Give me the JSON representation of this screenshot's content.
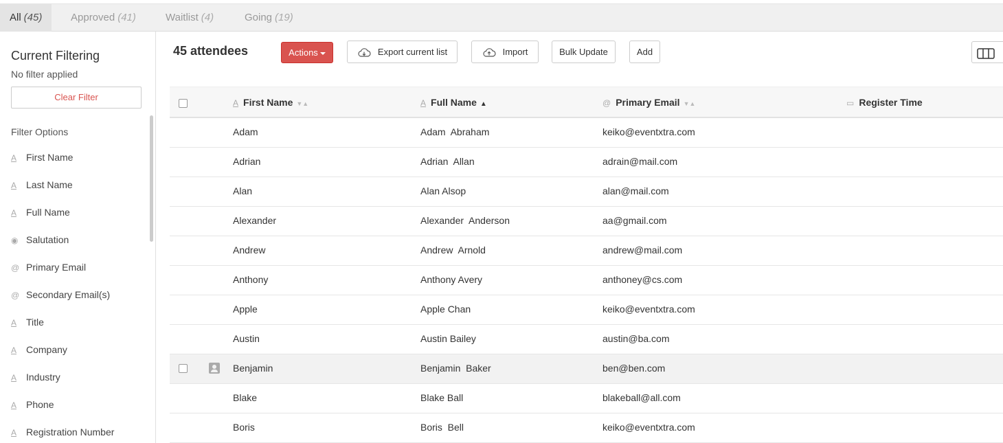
{
  "tabs": [
    {
      "label": "All",
      "count": "(45)"
    },
    {
      "label": "Approved",
      "count": "(41)"
    },
    {
      "label": "Waitlist",
      "count": "(4)"
    },
    {
      "label": "Going",
      "count": "(19)"
    }
  ],
  "sidebar": {
    "title": "Current Filtering",
    "subtitle": "No filter applied",
    "clear_label": "Clear Filter",
    "options_title": "Filter Options",
    "items": [
      {
        "label": "First Name",
        "icon": "text-icon"
      },
      {
        "label": "Last Name",
        "icon": "text-icon"
      },
      {
        "label": "Full Name",
        "icon": "text-icon"
      },
      {
        "label": "Salutation",
        "icon": "radio-icon"
      },
      {
        "label": "Primary Email",
        "icon": "at-icon"
      },
      {
        "label": "Secondary Email(s)",
        "icon": "at-icon"
      },
      {
        "label": "Title",
        "icon": "text-icon"
      },
      {
        "label": "Company",
        "icon": "text-icon"
      },
      {
        "label": "Industry",
        "icon": "text-icon"
      },
      {
        "label": "Phone",
        "icon": "text-icon"
      },
      {
        "label": "Registration Number",
        "icon": "text-icon"
      }
    ]
  },
  "toolbar": {
    "count_label": "45 attendees",
    "actions_label": "Actions",
    "export_label": "Export current list",
    "import_label": "Import",
    "bulk_update_label": "Bulk Update",
    "add_label": "Add",
    "accent_color": "#d9534f"
  },
  "table": {
    "columns": [
      {
        "label": "First Name",
        "icon": "text-icon",
        "sort": "none"
      },
      {
        "label": "Full Name",
        "icon": "text-icon",
        "sort": "ascending"
      },
      {
        "label": "Primary Email",
        "icon": "at-icon",
        "sort": "none"
      },
      {
        "label": "Register Time",
        "icon": "calendar-icon",
        "sort": "none"
      }
    ],
    "rows": [
      {
        "first": "Adam",
        "full": "Adam  Abraham",
        "email": "keiko@eventxtra.com",
        "time": ""
      },
      {
        "first": "Adrian",
        "full": "Adrian  Allan",
        "email": "adrain@mail.com",
        "time": ""
      },
      {
        "first": "Alan",
        "full": "Alan Alsop",
        "email": "alan@mail.com",
        "time": ""
      },
      {
        "first": "Alexander",
        "full": "Alexander  Anderson",
        "email": "aa@gmail.com",
        "time": ""
      },
      {
        "first": "Andrew",
        "full": "Andrew  Arnold",
        "email": "andrew@mail.com",
        "time": ""
      },
      {
        "first": "Anthony",
        "full": "Anthony Avery",
        "email": "anthoney@cs.com",
        "time": ""
      },
      {
        "first": "Apple",
        "full": "Apple Chan",
        "email": "keiko@eventxtra.com",
        "time": ""
      },
      {
        "first": "Austin",
        "full": "Austin Bailey",
        "email": "austin@ba.com",
        "time": ""
      },
      {
        "first": "Benjamin",
        "full": "Benjamin  Baker",
        "email": "ben@ben.com",
        "time": "",
        "hover": true
      },
      {
        "first": "Blake",
        "full": "Blake Ball",
        "email": "blakeball@all.com",
        "time": ""
      },
      {
        "first": "Boris",
        "full": "Boris  Bell",
        "email": "keiko@eventxtra.com",
        "time": ""
      }
    ]
  }
}
